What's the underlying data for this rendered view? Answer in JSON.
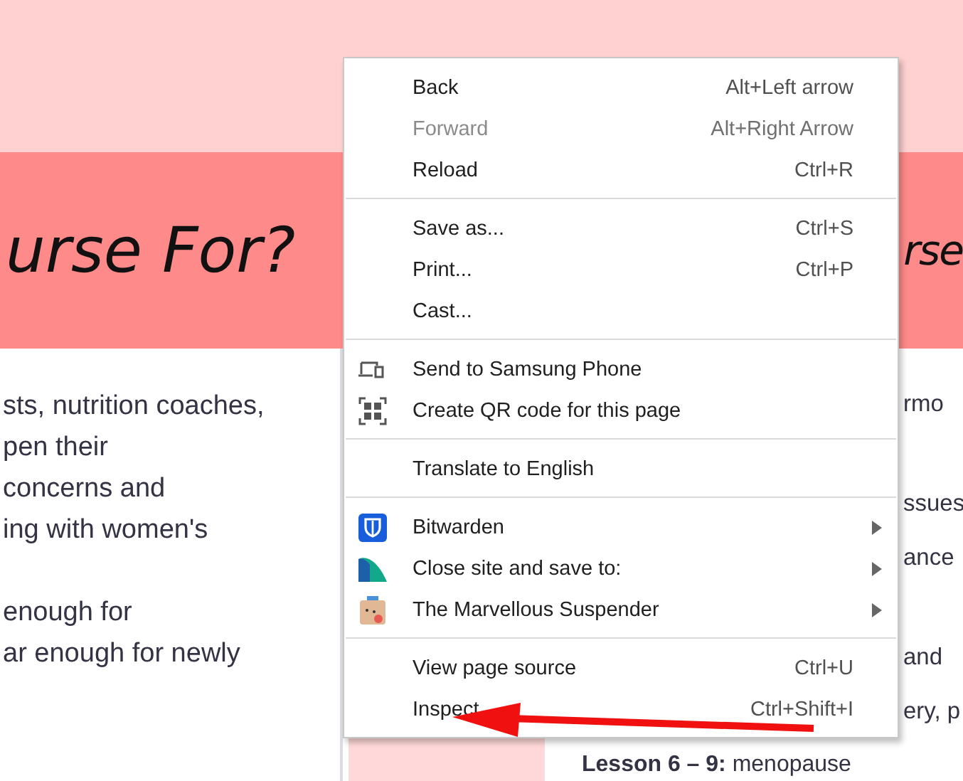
{
  "page": {
    "heading_left": "urse For?",
    "heading_right": "rse",
    "left_paragraphs": [
      [
        "sts, nutrition coaches,",
        "pen their",
        " concerns and",
        "ing with women's"
      ],
      [
        "enough for",
        "ar enough for newly"
      ]
    ],
    "right_paragraphs": [
      [
        "rmo"
      ],
      [
        "ssues",
        "ance"
      ],
      [
        "and",
        "ery, p"
      ]
    ],
    "bottom_line": "**Lesson 6 – 9:** menopause"
  },
  "context_menu": {
    "groups": [
      [
        {
          "label": "Back",
          "shortcut": "Alt+Left arrow",
          "disabled": false,
          "kind": "plain"
        },
        {
          "label": "Forward",
          "shortcut": "Alt+Right Arrow",
          "disabled": true,
          "kind": "plain"
        },
        {
          "label": "Reload",
          "shortcut": "Ctrl+R",
          "disabled": false,
          "kind": "plain"
        }
      ],
      [
        {
          "label": "Save as...",
          "shortcut": "Ctrl+S",
          "disabled": false,
          "kind": "plain"
        },
        {
          "label": "Print...",
          "shortcut": "Ctrl+P",
          "disabled": false,
          "kind": "plain"
        },
        {
          "label": "Cast...",
          "disabled": false,
          "kind": "plain"
        }
      ],
      [
        {
          "label": "Send to Samsung Phone",
          "disabled": false,
          "kind": "device"
        },
        {
          "label": "Create QR code for this page",
          "disabled": false,
          "kind": "qr"
        }
      ],
      [
        {
          "label": "Translate to English",
          "disabled": false,
          "kind": "plain"
        }
      ],
      [
        {
          "label": "Bitwarden",
          "disabled": false,
          "kind": "shield",
          "submenu": true
        },
        {
          "label": "Close site and save to:",
          "disabled": false,
          "kind": "fin",
          "submenu": true
        },
        {
          "label": "The Marvellous Suspender",
          "disabled": false,
          "kind": "box",
          "submenu": true
        }
      ],
      [
        {
          "label": "View page source",
          "shortcut": "Ctrl+U",
          "disabled": false,
          "kind": "plain"
        },
        {
          "label": "Inspect",
          "shortcut": "Ctrl+Shift+I",
          "disabled": false,
          "kind": "plain"
        }
      ]
    ]
  }
}
